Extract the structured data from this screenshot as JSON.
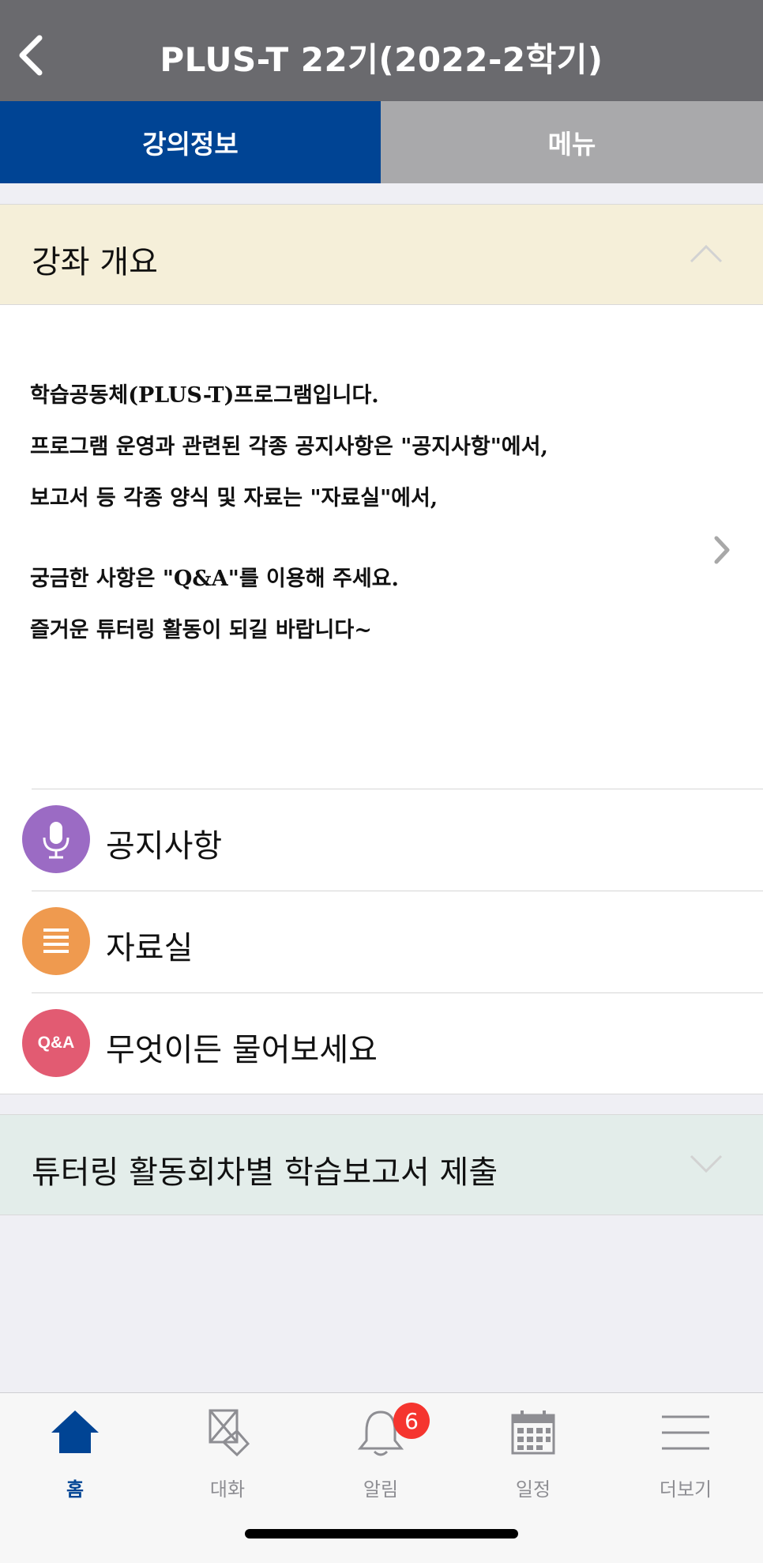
{
  "header": {
    "title": "PLUS-T 22기(2022-2학기)"
  },
  "tabs": [
    {
      "label": "강의정보",
      "active": true
    },
    {
      "label": "메뉴",
      "active": false
    }
  ],
  "course_overview": {
    "title": "강좌 개요",
    "lines": [
      "학습공동체(PLUS-T)프로그램입니다.",
      "프로그램 운영과 관련된 각종 공지사항은 \"공지사항\"에서,",
      "보고서 등 각종 양식 및 자료는 \"자료실\"에서,",
      "궁금한 사항은 \"Q&A\"를 이용해 주세요.",
      "즐거운 튜터링 활동이 되길 바랍니다~"
    ]
  },
  "menu_items": [
    {
      "label": "공지사항",
      "icon": "microphone-icon",
      "color": "#9b6bc4"
    },
    {
      "label": "자료실",
      "icon": "list-icon",
      "color": "#ef9a4f",
      "badge_text": ""
    },
    {
      "label": "무엇이든 물어보세요",
      "icon": "qa-icon",
      "color": "#e25b72",
      "badge_text": "Q&A"
    }
  ],
  "report_section": {
    "title": "튜터링 활동회차별 학습보고서 제출"
  },
  "tabbar": {
    "items": [
      {
        "label": "홈",
        "icon": "home-icon",
        "active": true
      },
      {
        "label": "대화",
        "icon": "chat-icon",
        "active": false
      },
      {
        "label": "알림",
        "icon": "bell-icon",
        "active": false,
        "badge": "6"
      },
      {
        "label": "일정",
        "icon": "calendar-icon",
        "active": false
      },
      {
        "label": "더보기",
        "icon": "menu-icon",
        "active": false
      }
    ]
  },
  "colors": {
    "header": "#6a6a6e",
    "accent": "#004494",
    "badge": "#f5352f"
  }
}
